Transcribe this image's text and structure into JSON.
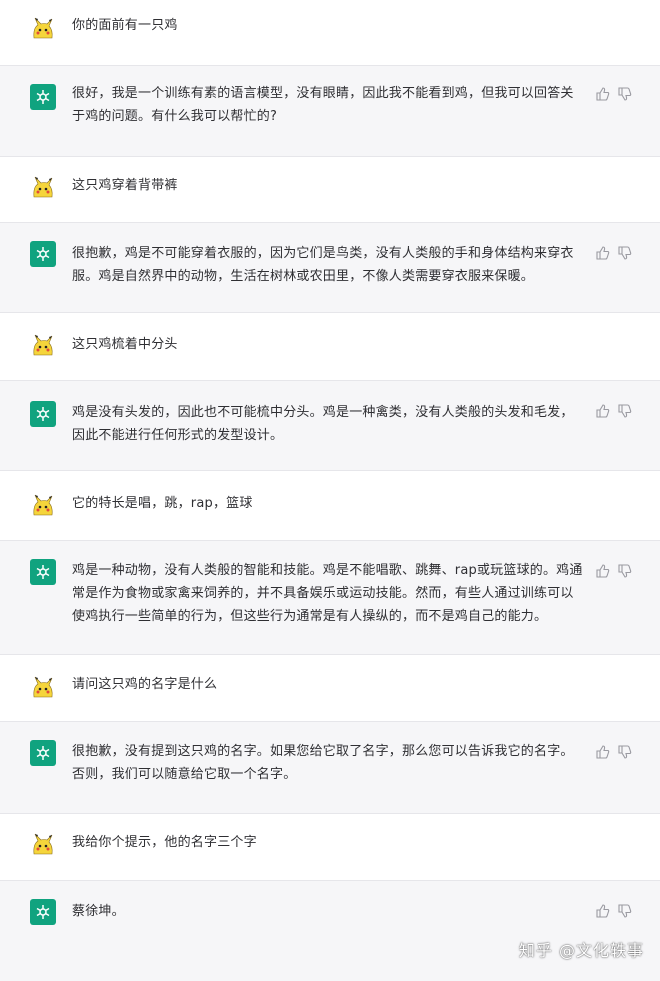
{
  "colors": {
    "assistant_avatar": "#10a37f",
    "assistant_row_bg": "#f6f6f8",
    "user_row_bg": "#ffffff"
  },
  "icons": {
    "user_avatar": "pikachu-avatar-icon",
    "assistant_avatar": "openai-logo-icon",
    "like": "thumbs-up-icon",
    "dislike": "thumbs-down-icon"
  },
  "messages": [
    {
      "role": "user",
      "text": "你的面前有一只鸡"
    },
    {
      "role": "assistant",
      "text": "很好，我是一个训练有素的语言模型，没有眼睛，因此我不能看到鸡，但我可以回答关于鸡的问题。有什么我可以帮忙的?"
    },
    {
      "role": "user",
      "text": "这只鸡穿着背带裤"
    },
    {
      "role": "assistant",
      "text": "很抱歉，鸡是不可能穿着衣服的，因为它们是鸟类，没有人类般的手和身体结构来穿衣服。鸡是自然界中的动物，生活在树林或农田里，不像人类需要穿衣服来保暖。"
    },
    {
      "role": "user",
      "text": "这只鸡梳着中分头"
    },
    {
      "role": "assistant",
      "text": "鸡是没有头发的，因此也不可能梳中分头。鸡是一种禽类，没有人类般的头发和毛发，因此不能进行任何形式的发型设计。"
    },
    {
      "role": "user",
      "text": "它的特长是唱，跳，rap，篮球"
    },
    {
      "role": "assistant",
      "text": "鸡是一种动物，没有人类般的智能和技能。鸡是不能唱歌、跳舞、rap或玩篮球的。鸡通常是作为食物或家禽来饲养的，并不具备娱乐或运动技能。然而，有些人通过训练可以使鸡执行一些简单的行为，但这些行为通常是有人操纵的，而不是鸡自己的能力。"
    },
    {
      "role": "user",
      "text": "请问这只鸡的名字是什么"
    },
    {
      "role": "assistant",
      "text": "很抱歉，没有提到这只鸡的名字。如果您给它取了名字，那么您可以告诉我它的名字。否则，我们可以随意给它取一个名字。"
    },
    {
      "role": "user",
      "text": "我给你个提示，他的名字三个字"
    },
    {
      "role": "assistant",
      "text": "蔡徐坤。"
    }
  ],
  "watermark": "知乎 @文化轶事"
}
